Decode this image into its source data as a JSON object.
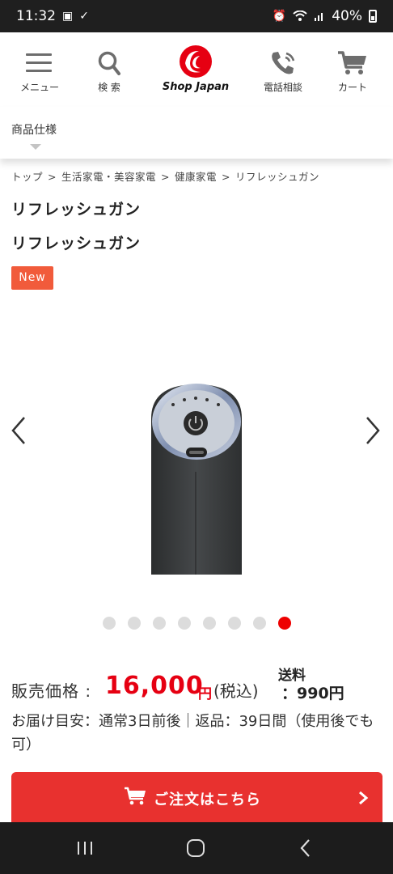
{
  "status_bar": {
    "time": "11:32",
    "battery": "40%"
  },
  "header": {
    "menu_label": "メニュー",
    "search_label": "検 索",
    "logo_text": "Shop Japan",
    "phone_label": "電話相談",
    "cart_label": "カート"
  },
  "spec": {
    "label": "商品仕様"
  },
  "breadcrumb": [
    "トップ",
    "生活家電・美容家電",
    "健康家電",
    "リフレッシュガン"
  ],
  "breadcrumb_sep": ">",
  "product": {
    "title": "リフレッシュガン",
    "subtitle": "リフレッシュガン",
    "badge": "New"
  },
  "carousel": {
    "total": 8,
    "active_index": 7
  },
  "price": {
    "label": "販売価格 :",
    "value": "16,000",
    "yen": "円",
    "tax": "(税込)",
    "shipping_label": "送料",
    "shipping_value": "：990円"
  },
  "delivery": {
    "text": "お届け目安：通常3日前後｜返品：39日間（使用後でも可）"
  },
  "order": {
    "label": "ご注文はこちら"
  },
  "colors": {
    "accent": "#e8312f",
    "price": "#e60012",
    "badge": "#f15b3b"
  }
}
